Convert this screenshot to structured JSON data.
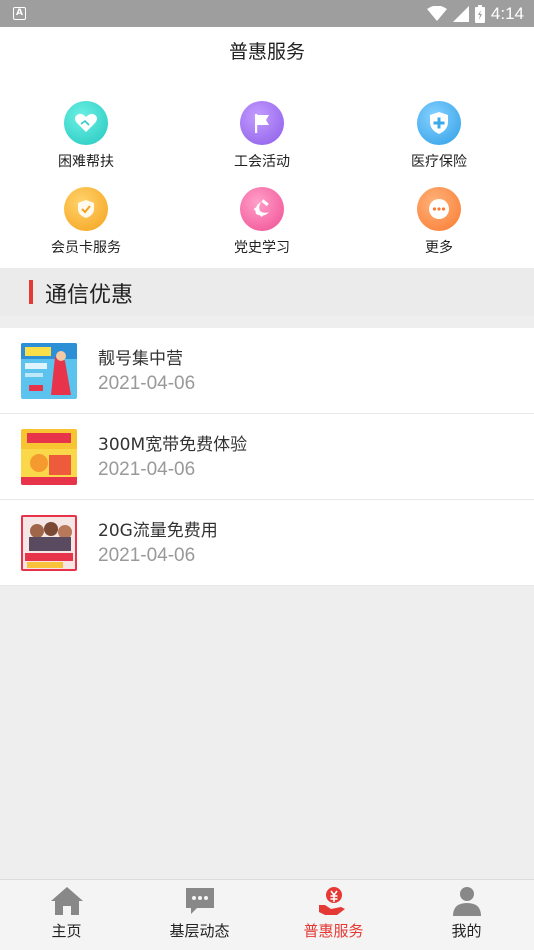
{
  "status_bar": {
    "time": "4:14",
    "notification_letter": "A"
  },
  "header": {
    "title": "普惠服务"
  },
  "services": [
    {
      "label": "困难帮扶",
      "icon": "heart-hands-icon",
      "color": "#2ecdc4"
    },
    {
      "label": "工会活动",
      "icon": "flag-icon",
      "color": "#9b6cf0"
    },
    {
      "label": "医疗保险",
      "icon": "shield-plus-icon",
      "color": "#3aa9ec"
    },
    {
      "label": "会员卡服务",
      "icon": "badge-icon",
      "color": "#f8ac26"
    },
    {
      "label": "党史学习",
      "icon": "hammer-sickle-icon",
      "color": "#f45fa0"
    },
    {
      "label": "更多",
      "icon": "more-icon",
      "color": "#fb8b3c"
    }
  ],
  "section": {
    "title": "通信优惠"
  },
  "news": [
    {
      "title": "靓号集中营",
      "date": "2021-04-06"
    },
    {
      "title": "300M宽带免费体验",
      "date": "2021-04-06"
    },
    {
      "title": "20G流量免费用",
      "date": "2021-04-06"
    }
  ],
  "tabs": [
    {
      "label": "主页",
      "icon": "home-icon"
    },
    {
      "label": "基层动态",
      "icon": "chat-bubble-icon"
    },
    {
      "label": "普惠服务",
      "icon": "yuan-hand-icon",
      "active": true
    },
    {
      "label": "我的",
      "icon": "person-icon"
    }
  ],
  "colors": {
    "accent": "#e53935"
  }
}
